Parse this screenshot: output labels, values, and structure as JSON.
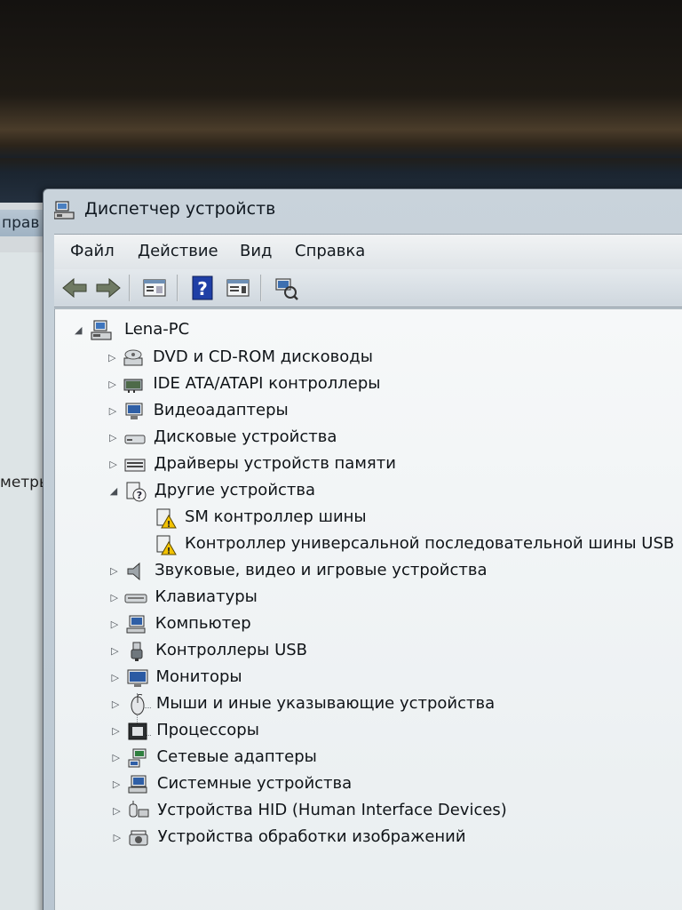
{
  "background_window": {
    "title_fragment": "прав",
    "side_text": "метры"
  },
  "window": {
    "title": "Диспетчер устройств"
  },
  "menu": {
    "file": "Файл",
    "action": "Действие",
    "view": "Вид",
    "help": "Справка"
  },
  "toolbar": {
    "buttons": [
      "back-arrow-icon",
      "forward-arrow-icon",
      "properties-icon",
      "help-icon",
      "update-driver-icon",
      "scan-hardware-icon"
    ]
  },
  "tree": {
    "root": "Lena-PC",
    "items": [
      {
        "label": "DVD и CD-ROM дисководы",
        "icon": "dvd-drive-icon",
        "expanded": false
      },
      {
        "label": "IDE ATA/ATAPI контроллеры",
        "icon": "ide-controller-icon",
        "expanded": false
      },
      {
        "label": "Видеоадаптеры",
        "icon": "display-adapter-icon",
        "expanded": false
      },
      {
        "label": "Дисковые устройства",
        "icon": "disk-drive-icon",
        "expanded": false
      },
      {
        "label": "Драйверы устройств памяти",
        "icon": "memory-device-icon",
        "expanded": false
      },
      {
        "label": "Другие устройства",
        "icon": "unknown-device-icon",
        "expanded": true
      },
      {
        "label": "Звуковые, видео и игровые устройства",
        "icon": "speaker-icon",
        "expanded": false
      },
      {
        "label": "Клавиатуры",
        "icon": "keyboard-icon",
        "expanded": false
      },
      {
        "label": "Компьютер",
        "icon": "computer-icon",
        "expanded": false
      },
      {
        "label": "Контроллеры USB",
        "icon": "usb-icon",
        "expanded": false
      },
      {
        "label": "Мониторы",
        "icon": "monitor-icon",
        "expanded": false
      },
      {
        "label": "Мыши и иные указывающие устройства",
        "icon": "mouse-icon",
        "expanded": false
      },
      {
        "label": "Процессоры",
        "icon": "processor-icon",
        "expanded": false
      },
      {
        "label": "Сетевые адаптеры",
        "icon": "network-adapter-icon",
        "expanded": false
      },
      {
        "label": "Системные устройства",
        "icon": "system-device-icon",
        "expanded": false
      },
      {
        "label": "Устройства HID (Human Interface Devices)",
        "icon": "hid-device-icon",
        "expanded": false
      },
      {
        "label": "Устройства обработки изображений",
        "icon": "imaging-device-icon",
        "expanded": false
      }
    ],
    "other_devices_children": [
      {
        "label": "SM контроллер шины",
        "icon": "warning-device-icon"
      },
      {
        "label": "Контроллер универсальной последовательной шины USB",
        "icon": "warning-device-icon"
      }
    ]
  },
  "colors": {
    "warning": "#f2c200",
    "selection_blue": "#2b5fa8"
  }
}
